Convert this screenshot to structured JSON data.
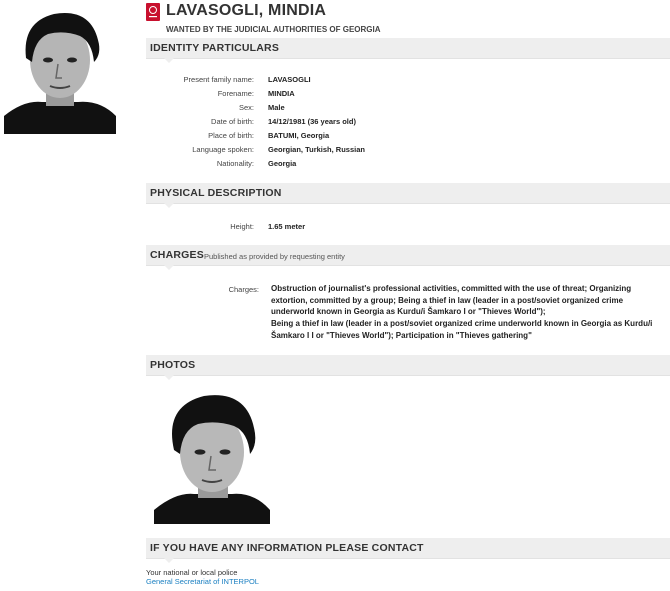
{
  "header": {
    "name": "LAVASOGLI, MINDIA",
    "wanted_by": "WANTED BY THE JUDICIAL AUTHORITIES OF GEORGIA",
    "notice_icon": "red-notice-icon",
    "accent_color": "#c8102e"
  },
  "identity": {
    "section_title": "IDENTITY PARTICULARS",
    "rows": [
      {
        "label": "Present family name:",
        "value": "LAVASOGLI"
      },
      {
        "label": "Forename:",
        "value": "MINDIA"
      },
      {
        "label": "Sex:",
        "value": "Male"
      },
      {
        "label": "Date of birth:",
        "value": "14/12/1981 (36 years old)"
      },
      {
        "label": "Place of birth:",
        "value": "BATUMI, Georgia"
      },
      {
        "label": "Language spoken:",
        "value": "Georgian, Turkish, Russian"
      },
      {
        "label": "Nationality:",
        "value": "Georgia"
      }
    ]
  },
  "physical": {
    "section_title": "PHYSICAL DESCRIPTION",
    "rows": [
      {
        "label": "Height:",
        "value": "1.65 meter"
      }
    ]
  },
  "charges": {
    "section_title": "CHARGES",
    "note": "Published as provided by requesting entity",
    "label": "Charges:",
    "paragraphs": [
      "Obstruction of journalist's professional activities, committed with the use of threat; Organizing extortion, committed by a group; Being a thief in law (leader in a post/soviet organized crime underworld known in Georgia as Kurdu/i Šamkaro I or \"Thieves World\");",
      "Being a thief in law (leader in a post/soviet organized crime underworld known in Georgia as Kurdu/i Šamkaro I I or \"Thieves World\"); Participation in \"Thieves gathering\""
    ]
  },
  "photos": {
    "section_title": "PHOTOS"
  },
  "contact": {
    "section_title": "IF YOU HAVE ANY INFORMATION PLEASE CONTACT",
    "line1": "Your national or local police",
    "link": "General Secretariat of INTERPOL",
    "link_color": "#1a7fc1"
  }
}
